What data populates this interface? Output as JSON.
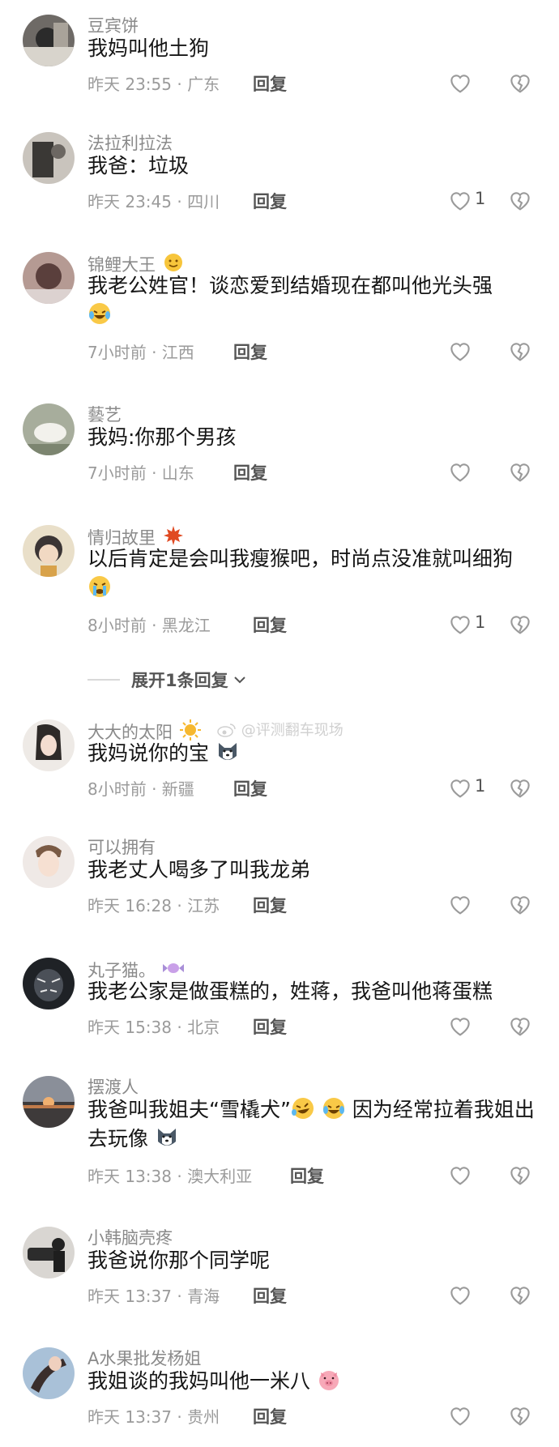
{
  "reply_label": "回复",
  "expand_text": "展开1条回复",
  "watermark_text": "@评测翻车现场",
  "comments": [
    {
      "username": "豆宾饼",
      "text": "我妈叫他土狗",
      "meta": "昨天 23:55 · 广东",
      "likes": ""
    },
    {
      "username": "法拉利拉法",
      "text": "我爸：垃圾",
      "meta": "昨天 23:45 · 四川",
      "likes": "1"
    },
    {
      "username": "锦鲤大王",
      "text": "我老公姓官！谈恋爱到结婚现在都叫他光头强",
      "meta": "7小时前 · 江西",
      "likes": ""
    },
    {
      "username": "藝艺",
      "text": "我妈:你那个男孩",
      "meta": "7小时前 · 山东",
      "likes": ""
    },
    {
      "username": "情归故里",
      "text": "以后肯定是会叫我瘦猴吧，时尚点没准就叫细狗",
      "meta": "8小时前 · 黑龙江",
      "likes": "1"
    },
    {
      "username": "大大的太阳",
      "text": "我妈说你的宝",
      "meta": "8小时前 · 新疆",
      "likes": "1"
    },
    {
      "username": "可以拥有",
      "text": "我老丈人喝多了叫我龙弟",
      "meta": "昨天 16:28 · 江苏",
      "likes": ""
    },
    {
      "username": "丸子猫。",
      "text": "我老公家是做蛋糕的，姓蒋，我爸叫他蒋蛋糕",
      "meta": "昨天 15:38 · 北京",
      "likes": ""
    },
    {
      "username": "摆渡人",
      "text": "我爸叫我姐夫“雪橇犬”",
      "text2": "因为经常拉着我姐出去玩像",
      "meta": "昨天 13:38 · 澳大利亚",
      "likes": ""
    },
    {
      "username": "小韩脑壳疼",
      "text": "我爸说你那个同学呢",
      "meta": "昨天 13:37 · 青海",
      "likes": ""
    },
    {
      "username": "A水果批发杨姐",
      "text": "我姐谈的我妈叫他一米八",
      "meta": "昨天 13:37 · 贵州",
      "likes": ""
    }
  ]
}
